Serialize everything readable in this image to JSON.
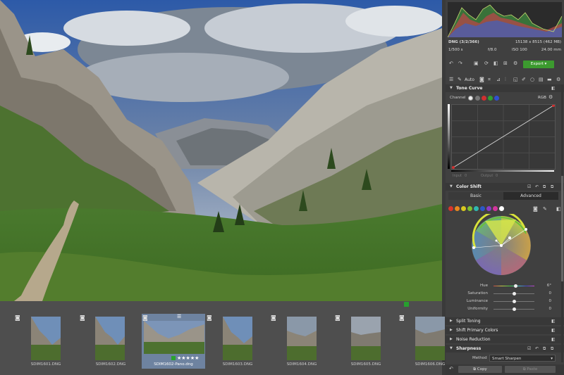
{
  "filmstrip": {
    "thumbs": [
      {
        "label": "SDIM1601.DNG"
      },
      {
        "label": "SDIM1602.DNG"
      },
      {
        "label": "SDIM1602-Pano.dng",
        "stars": "★★★★★"
      },
      {
        "label": "SDIM1603.DNG"
      },
      {
        "label": "SDIM1604.DNG"
      },
      {
        "label": "SDIM1605.DNG"
      },
      {
        "label": "SDIM1606.DNG"
      }
    ]
  },
  "info": {
    "file": "DNG (3/2/366)",
    "dimensions": "15138 x 8515 (462 MB)",
    "shutter": "1/500 s",
    "aperture": "f/8.0",
    "iso": "ISO 100",
    "focal": "24.00 mm"
  },
  "toolbar": {
    "export_label": "Export"
  },
  "tools": {
    "auto_label": "Auto"
  },
  "tone_curve": {
    "title": "Tone Curve",
    "channel_label": "Channel",
    "rgb_label": "RGB",
    "input_label": "Input",
    "output_label": "Output",
    "input_value": "0",
    "output_value": "0"
  },
  "color_shift": {
    "title": "Color Shift",
    "tab_basic": "Basic",
    "tab_advanced": "Advanced",
    "swatches": [
      "#d9352b",
      "#e8881f",
      "#d9c81f",
      "#7ec030",
      "#2fb8b0",
      "#2b58c8",
      "#8b3cc8",
      "#d3359c",
      "#ffffff"
    ],
    "sliders": [
      {
        "label": "Hue",
        "value": "6°",
        "fraction": 0.55
      },
      {
        "label": "Saturation",
        "value": "0",
        "fraction": 0.5
      },
      {
        "label": "Luminance",
        "value": "0",
        "fraction": 0.5
      },
      {
        "label": "Uniformity",
        "value": "0",
        "fraction": 0.5
      }
    ]
  },
  "sections": {
    "split_toning": "Split Toning",
    "shift_primary": "Shift Primary Colors",
    "noise_reduction": "Noise Reduction",
    "sharpness": "Sharpness"
  },
  "sharpness": {
    "method_label": "Method",
    "method_value": "Smart Sharpen"
  },
  "footer": {
    "copy_label": "Copy",
    "paste_label": "Paste"
  },
  "colors": {
    "accent_green": "#3c9a2f",
    "selection_blue": "#6e83a0"
  }
}
